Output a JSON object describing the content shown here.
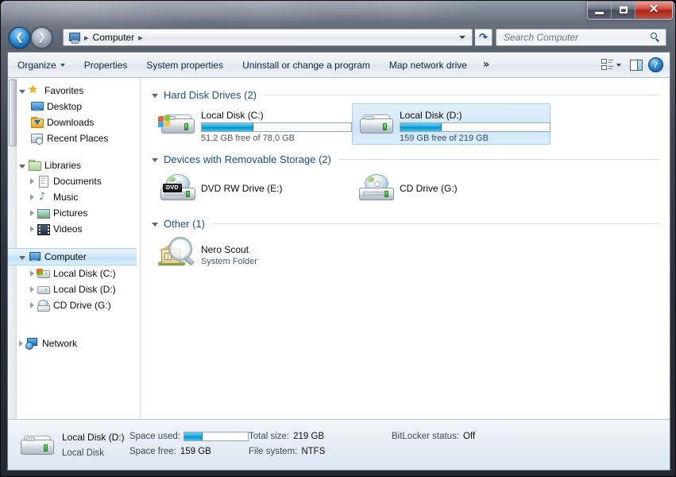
{
  "window": {
    "title": "Computer",
    "caption_buttons": {
      "minimize": "Minimize",
      "maximize": "Maximize",
      "close": "Close"
    }
  },
  "navigation": {
    "back_label": "Back",
    "forward_label": "Forward",
    "recent_pages_label": "Recent pages",
    "breadcrumb": [
      "Computer"
    ],
    "breadcrumb_separator": "▶",
    "address_dropdown": "Previous locations",
    "refresh_label": "Refresh",
    "search": {
      "placeholder": "Search Computer",
      "value": ""
    }
  },
  "commandbar": {
    "organize": "Organize",
    "properties": "Properties",
    "system_properties": "System properties",
    "uninstall": "Uninstall or change a program",
    "map_network_drive": "Map network drive",
    "overflow": "»",
    "views": "Change your view",
    "preview_pane": "Show the preview pane",
    "help": "Get help",
    "help_glyph": "?"
  },
  "navpane": {
    "sections": [
      {
        "name": "Favorites",
        "icon": "star-icon",
        "expanded": true,
        "children": [
          {
            "label": "Desktop",
            "icon": "desktop-icon"
          },
          {
            "label": "Downloads",
            "icon": "downloads-folder-icon"
          },
          {
            "label": "Recent Places",
            "icon": "recent-places-icon"
          }
        ]
      },
      {
        "name": "Libraries",
        "icon": "libraries-icon",
        "expanded": true,
        "children": [
          {
            "label": "Documents",
            "icon": "documents-icon"
          },
          {
            "label": "Music",
            "icon": "music-icon"
          },
          {
            "label": "Pictures",
            "icon": "pictures-icon"
          },
          {
            "label": "Videos",
            "icon": "videos-icon"
          }
        ]
      },
      {
        "name": "Computer",
        "icon": "computer-icon",
        "expanded": true,
        "selected": true,
        "children": [
          {
            "label": "Local Disk (C:)",
            "icon": "hard-drive-icon"
          },
          {
            "label": "Local Disk (D:)",
            "icon": "hard-drive-icon"
          },
          {
            "label": "CD Drive (G:)",
            "icon": "cd-drive-icon"
          }
        ]
      },
      {
        "name": "Network",
        "icon": "network-icon",
        "expanded": false,
        "children": []
      }
    ]
  },
  "content": {
    "groups": [
      {
        "title": "Hard Disk Drives (2)",
        "items": [
          {
            "name": "Local Disk (C:)",
            "sub": "51,2 GB free of 78,0 GB",
            "icon": "hard-drive-windows-icon",
            "has_capacity_bar": true,
            "used_percent": 34,
            "selected": false
          },
          {
            "name": "Local Disk (D:)",
            "sub": "159 GB free of 219 GB",
            "icon": "hard-drive-icon",
            "has_capacity_bar": true,
            "used_percent": 27,
            "selected": true
          }
        ]
      },
      {
        "title": "Devices with Removable Storage (2)",
        "items": [
          {
            "name": "DVD RW Drive (E:)",
            "sub": "",
            "icon": "dvd-rw-drive-icon",
            "badge": "DVD",
            "has_capacity_bar": false,
            "selected": false
          },
          {
            "name": "CD Drive (G:)",
            "sub": "",
            "icon": "cd-drive-icon",
            "has_capacity_bar": false,
            "selected": false
          }
        ]
      },
      {
        "title": "Other (1)",
        "items": [
          {
            "name": "Nero Scout",
            "sub": "System Folder",
            "icon": "nero-scout-icon",
            "has_capacity_bar": false,
            "selected": false
          }
        ]
      }
    ]
  },
  "details": {
    "item_name": "Local Disk (D:)",
    "item_type": "Local Disk",
    "space_used_label": "Space used:",
    "space_used_percent": 27,
    "space_free_label": "Space free:",
    "space_free_value": "159 GB",
    "total_size_label": "Total size:",
    "total_size_value": "219 GB",
    "file_system_label": "File system:",
    "file_system_value": "NTFS",
    "bitlocker_label": "BitLocker status:",
    "bitlocker_value": "Off"
  },
  "colors": {
    "accent_blue": "#13a9de",
    "group_header": "#1c4e7f",
    "selection_fill": "#cbe3f6",
    "selection_border": "#a3cdea",
    "close_button": "#c9392c"
  }
}
